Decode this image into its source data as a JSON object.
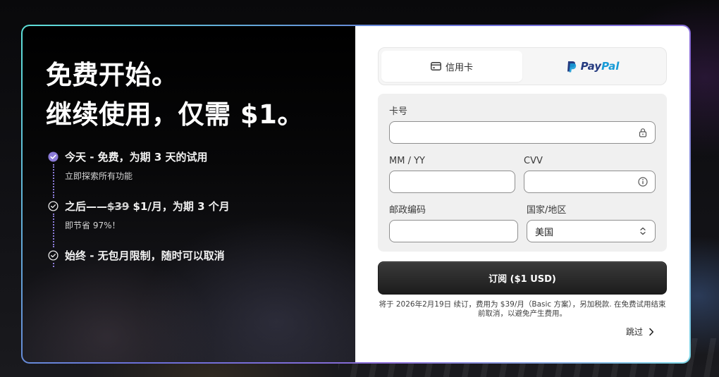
{
  "promo": {
    "headline_line1": "免费开始。",
    "headline_line2": "继续使用，仅需 $1。"
  },
  "features": [
    {
      "title": "今天 - 免费，为期 3 天的试用",
      "subtitle": "立即探索所有功能",
      "icon": "check-filled-icon"
    },
    {
      "title_prefix": "之后——",
      "title_strike": "$39",
      "title_suffix": " $1/月，为期 3 个月",
      "subtitle": "即节省 97%！",
      "icon": "check-outline-icon"
    },
    {
      "title": "始终 - 无包月限制，随时可以取消",
      "icon": "check-outline-icon"
    }
  ],
  "payment_tabs": {
    "card_label": "信用卡",
    "paypal_part1": "Pay",
    "paypal_part2": "Pal"
  },
  "form": {
    "card_number_label": "卡号",
    "card_number_value": "",
    "expiry_label": "MM / YY",
    "expiry_value": "",
    "cvv_label": "CVV",
    "cvv_value": "",
    "zip_label": "邮政编码",
    "zip_value": "",
    "country_label": "国家/地区",
    "country_value": "美国"
  },
  "subscribe_label": "订阅 ($1 USD)",
  "terms_text": "将于 2026年2月19日 续订，费用为 $39/月（Basic 方案），另加税款. 在免费试用结束前取消，以避免产生费用。",
  "skip_label": "跳过",
  "colors": {
    "accent_purple": "#8b7bd8",
    "border_gradient_start": "#5de0d8",
    "border_gradient_mid": "#6a6fd8",
    "paypal_dark": "#253b80",
    "paypal_light": "#179bd7"
  }
}
